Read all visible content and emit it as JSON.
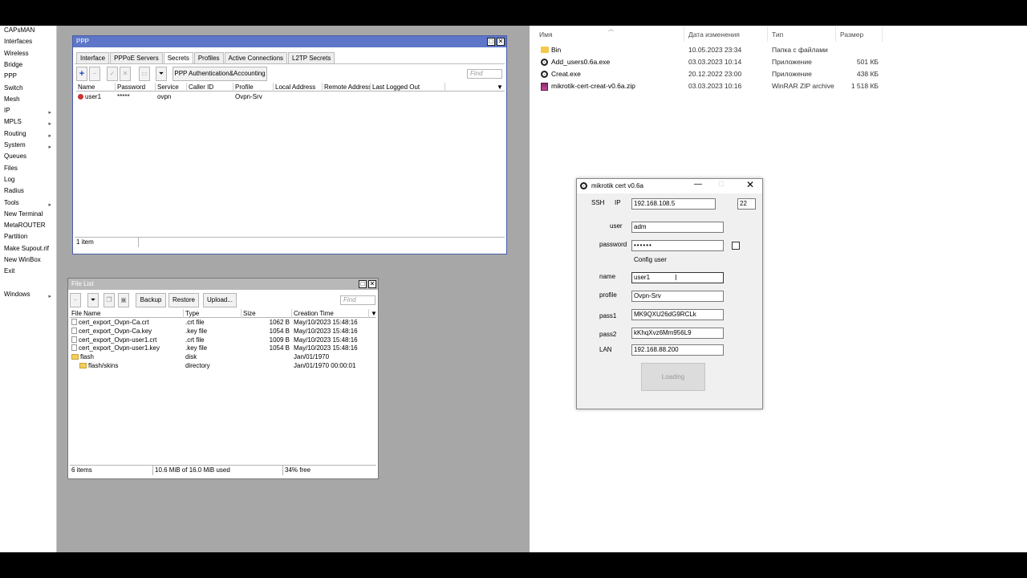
{
  "winbox_menu": [
    {
      "label": "CAPsMAN",
      "arrow": false
    },
    {
      "label": "Interfaces",
      "arrow": false
    },
    {
      "label": "Wireless",
      "arrow": false
    },
    {
      "label": "Bridge",
      "arrow": false
    },
    {
      "label": "PPP",
      "arrow": false
    },
    {
      "label": "Switch",
      "arrow": false
    },
    {
      "label": "Mesh",
      "arrow": false
    },
    {
      "label": "IP",
      "arrow": true
    },
    {
      "label": "MPLS",
      "arrow": true
    },
    {
      "label": "Routing",
      "arrow": true
    },
    {
      "label": "System",
      "arrow": true
    },
    {
      "label": "Queues",
      "arrow": false
    },
    {
      "label": "Files",
      "arrow": false
    },
    {
      "label": "Log",
      "arrow": false
    },
    {
      "label": "Radius",
      "arrow": false
    },
    {
      "label": "Tools",
      "arrow": true
    },
    {
      "label": "New Terminal",
      "arrow": false
    },
    {
      "label": "MetaROUTER",
      "arrow": false
    },
    {
      "label": "Partition",
      "arrow": false
    },
    {
      "label": "Make Supout.rif",
      "arrow": false
    },
    {
      "label": "New WinBox",
      "arrow": false
    },
    {
      "label": "Exit",
      "arrow": false
    },
    {
      "label": "",
      "arrow": false
    },
    {
      "label": "Windows",
      "arrow": true
    }
  ],
  "ppp_window": {
    "title": "PPP",
    "tabs": [
      "Interface",
      "PPPoE Servers",
      "Secrets",
      "Profiles",
      "Active Connections",
      "L2TP Secrets"
    ],
    "active_tab": "Secrets",
    "auth_button": "PPP Authentication&Accounting",
    "find_placeholder": "Find",
    "columns": [
      "Name",
      "Password",
      "Service",
      "Caller ID",
      "Profile",
      "Local Address",
      "Remote Address",
      "Last Logged Out"
    ],
    "rows": [
      [
        "user1",
        "*****",
        "ovpn",
        "",
        "Ovpn-Srv",
        "",
        "",
        ""
      ]
    ],
    "status": "1 item"
  },
  "file_window": {
    "title": "File List",
    "buttons": {
      "backup": "Backup",
      "restore": "Restore",
      "upload": "Upload..."
    },
    "find_placeholder": "Find",
    "columns": [
      "File Name",
      "Type",
      "Size",
      "Creation Time"
    ],
    "rows": [
      {
        "name": "cert_export_Ovpn-Ca.crt",
        "type": ".crt file",
        "size": "1062 B",
        "time": "May/10/2023 15:48:16",
        "folder": false,
        "indent": false
      },
      {
        "name": "cert_export_Ovpn-Ca.key",
        "type": ".key file",
        "size": "1054 B",
        "time": "May/10/2023 15:48:16",
        "folder": false,
        "indent": false
      },
      {
        "name": "cert_export_Ovpn-user1.crt",
        "type": ".crt file",
        "size": "1009 B",
        "time": "May/10/2023 15:48:16",
        "folder": false,
        "indent": false
      },
      {
        "name": "cert_export_Ovpn-user1.key",
        "type": ".key file",
        "size": "1054 B",
        "time": "May/10/2023 15:48:16",
        "folder": false,
        "indent": false
      },
      {
        "name": "flash",
        "type": "disk",
        "size": "",
        "time": "Jan/01/1970",
        "folder": true,
        "indent": false
      },
      {
        "name": "flash/skins",
        "type": "directory",
        "size": "",
        "time": "Jan/01/1970 00:00:01",
        "folder": true,
        "indent": true
      }
    ],
    "status": [
      "6 items",
      "10.6 MiB of 16.0 MiB used",
      "34% free"
    ]
  },
  "explorer": {
    "columns": [
      "Имя",
      "Дата изменения",
      "Тип",
      "Размер"
    ],
    "files": [
      {
        "name": "Bin",
        "date": "10.05.2023 23:34",
        "type": "Папка с файлами",
        "size": "",
        "icon": "folder-icon"
      },
      {
        "name": "Add_users0.6a.exe",
        "date": "03.03.2023 10:14",
        "type": "Приложение",
        "size": "501 КБ",
        "icon": "app-icon"
      },
      {
        "name": "Creat.exe",
        "date": "20.12.2022 23:00",
        "type": "Приложение",
        "size": "438 КБ",
        "icon": "app-icon"
      },
      {
        "name": "mikrotik-cert-creat-v0.6a.zip",
        "date": "03.03.2023 10:16",
        "type": "WinRAR ZIP archive",
        "size": "1 518 КБ",
        "icon": "zip-icon"
      }
    ]
  },
  "cert_dialog": {
    "title": "mikrotik cert v0.6a",
    "ssh_label": "SSH",
    "ip_label": "IP",
    "ip": "192.168.108.5",
    "port": "22",
    "user_label": "user",
    "user": "adm",
    "password_label": "password",
    "password": "••••••",
    "config_user": "Config user",
    "name_label": "name",
    "name": "user1",
    "profile_label": "profile",
    "profile": "Ovpn-Srv",
    "pass1_label": "pass1",
    "pass1": "MK9QXU26dG9RCLk",
    "pass2_label": "pass2",
    "pass2": "kKhqXvz6Mm956L9",
    "lan_label": "LAN",
    "lan": "192.168.88.200",
    "loading_button": "Loading"
  }
}
